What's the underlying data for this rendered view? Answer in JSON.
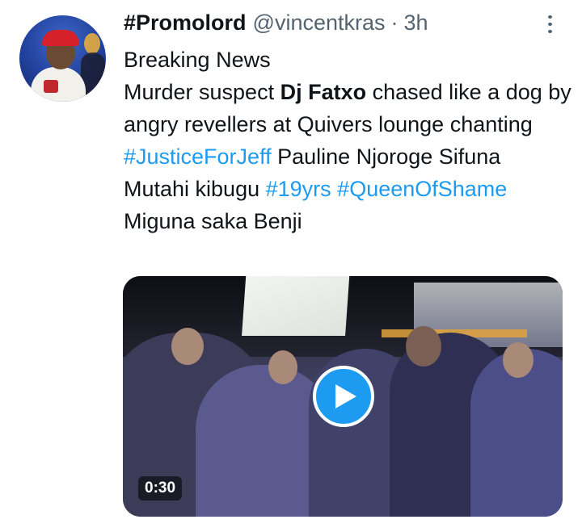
{
  "author": {
    "display_name": "#Promolord",
    "handle": "@vincentkras",
    "separator": "·",
    "time": "3h",
    "avatar_icon": "profile-photo-avatar"
  },
  "menu": {
    "icon": "more-vertical-icon"
  },
  "tweet": {
    "line1": "Breaking News",
    "line2_pre": "Murder suspect ",
    "line2_bold": "Dj Fatxo",
    "line2_post": " chased like a dog by angry revellers at Quivers lounge chanting ",
    "tag_justice": "#JusticeForJeff",
    "line2_end": " Pauline Njoroge Sifuna",
    "line3_pre": "Mutahi kibugu ",
    "tag_19yrs": "#19yrs",
    "line3_space": " ",
    "tag_queen": "#QueenOfShame",
    "line4": "Miguna saka Benji"
  },
  "video": {
    "duration": "0:30",
    "play_icon": "play-icon",
    "accent_color": "#1d9bf0"
  },
  "colors": {
    "text": "#0f1419",
    "muted": "#536471",
    "link": "#1d9bf0"
  }
}
